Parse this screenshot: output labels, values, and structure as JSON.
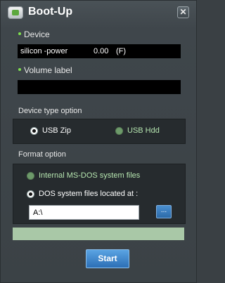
{
  "window": {
    "title": "Boot-Up",
    "close_label": "✕"
  },
  "device": {
    "label": "Device",
    "name": "silicon -power",
    "size": "0.00",
    "drive": "(F)"
  },
  "volume": {
    "label": "Volume label",
    "value": ""
  },
  "device_type": {
    "label": "Device type option",
    "options": [
      {
        "label": "USB Zip",
        "selected": true,
        "enabled": true
      },
      {
        "label": "USB Hdd",
        "selected": false,
        "enabled": false
      }
    ]
  },
  "format": {
    "label": "Format option",
    "options": [
      {
        "label": "Internal MS-DOS system files",
        "selected": false,
        "enabled": false
      },
      {
        "label": "DOS system files located at :",
        "selected": true,
        "enabled": true
      }
    ],
    "path_value": "A:\\",
    "browse_label": "..."
  },
  "progress": {
    "value": 0
  },
  "start_label": "Start",
  "colors": {
    "accent_green": "#7fe04f",
    "disabled_green": "#b6e6b0",
    "button_blue": "#2c6fb5"
  }
}
